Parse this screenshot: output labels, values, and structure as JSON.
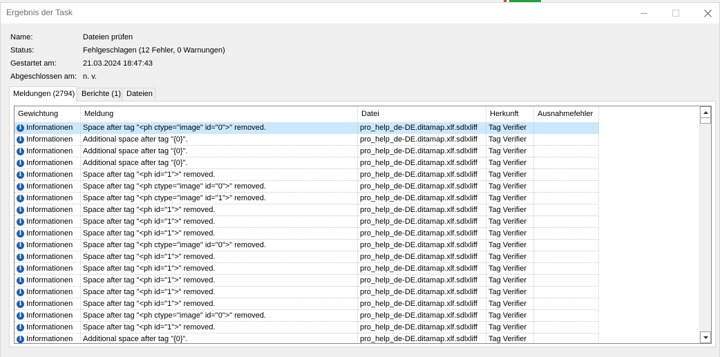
{
  "window": {
    "title": "Ergebnis der Task"
  },
  "properties": [
    {
      "label": "Name:",
      "value": "Dateien prüfen"
    },
    {
      "label": "Status:",
      "value": "Fehlgeschlagen (12 Fehler, 0 Warnungen)"
    },
    {
      "label": "Gestartet am:",
      "value": "21.03.2024 18:47:43"
    },
    {
      "label": "Abgeschlossen am:",
      "value": "n. v."
    }
  ],
  "tabs": [
    {
      "label": "Meldungen (2794)",
      "active": true
    },
    {
      "label": "Berichte (1)",
      "active": false
    },
    {
      "label": "Dateien",
      "active": false
    }
  ],
  "table": {
    "columns": [
      "Gewichtung",
      "Meldung",
      "Datei",
      "Herkunft",
      "Ausnahmefehler"
    ],
    "rows": [
      [
        "Informationen",
        "Space after tag \"<ph ctype=\"image\" id=\"0\">\" removed.",
        "pro_help_de-DE.ditamap.xlf.sdlxliff",
        "Tag Verifier",
        ""
      ],
      [
        "Informationen",
        "Additional space after tag \"{0}\".",
        "pro_help_de-DE.ditamap.xlf.sdlxliff",
        "Tag Verifier",
        ""
      ],
      [
        "Informationen",
        "Additional space after tag \"{0}\".",
        "pro_help_de-DE.ditamap.xlf.sdlxliff",
        "Tag Verifier",
        ""
      ],
      [
        "Informationen",
        "Additional space after tag \"{0}\".",
        "pro_help_de-DE.ditamap.xlf.sdlxliff",
        "Tag Verifier",
        ""
      ],
      [
        "Informationen",
        "Space after tag \"<ph id=\"1\">\" removed.",
        "pro_help_de-DE.ditamap.xlf.sdlxliff",
        "Tag Verifier",
        ""
      ],
      [
        "Informationen",
        "Space after tag \"<ph ctype=\"image\" id=\"0\">\" removed.",
        "pro_help_de-DE.ditamap.xlf.sdlxliff",
        "Tag Verifier",
        ""
      ],
      [
        "Informationen",
        "Space after tag \"<ph ctype=\"image\" id=\"1\">\" removed.",
        "pro_help_de-DE.ditamap.xlf.sdlxliff",
        "Tag Verifier",
        ""
      ],
      [
        "Informationen",
        "Space after tag \"<ph id=\"1\">\" removed.",
        "pro_help_de-DE.ditamap.xlf.sdlxliff",
        "Tag Verifier",
        ""
      ],
      [
        "Informationen",
        "Space after tag \"<ph id=\"1\">\" removed.",
        "pro_help_de-DE.ditamap.xlf.sdlxliff",
        "Tag Verifier",
        ""
      ],
      [
        "Informationen",
        "Space after tag \"<ph id=\"1\">\" removed.",
        "pro_help_de-DE.ditamap.xlf.sdlxliff",
        "Tag Verifier",
        ""
      ],
      [
        "Informationen",
        "Space after tag \"<ph ctype=\"image\" id=\"0\">\" removed.",
        "pro_help_de-DE.ditamap.xlf.sdlxliff",
        "Tag Verifier",
        ""
      ],
      [
        "Informationen",
        "Space after tag \"<ph id=\"1\">\" removed.",
        "pro_help_de-DE.ditamap.xlf.sdlxliff",
        "Tag Verifier",
        ""
      ],
      [
        "Informationen",
        "Space after tag \"<ph id=\"1\">\" removed.",
        "pro_help_de-DE.ditamap.xlf.sdlxliff",
        "Tag Verifier",
        ""
      ],
      [
        "Informationen",
        "Space after tag \"<ph id=\"1\">\" removed.",
        "pro_help_de-DE.ditamap.xlf.sdlxliff",
        "Tag Verifier",
        ""
      ],
      [
        "Informationen",
        "Space after tag \"<ph id=\"1\">\" removed.",
        "pro_help_de-DE.ditamap.xlf.sdlxliff",
        "Tag Verifier",
        ""
      ],
      [
        "Informationen",
        "Space after tag \"<ph id=\"1\">\" removed.",
        "pro_help_de-DE.ditamap.xlf.sdlxliff",
        "Tag Verifier",
        ""
      ],
      [
        "Informationen",
        "Space after tag \"<ph ctype=\"image\" id=\"0\">\" removed.",
        "pro_help_de-DE.ditamap.xlf.sdlxliff",
        "Tag Verifier",
        ""
      ],
      [
        "Informationen",
        "Space after tag \"<ph id=\"1\">\" removed.",
        "pro_help_de-DE.ditamap.xlf.sdlxliff",
        "Tag Verifier",
        ""
      ],
      [
        "Informationen",
        "Additional space after tag \"{0}\".",
        "pro_help_de-DE.ditamap.xlf.sdlxliff",
        "Tag Verifier",
        ""
      ]
    ],
    "selected_row": 0,
    "severity_icon": "info-icon"
  },
  "colors": {
    "selection": "#cce8ff",
    "info_icon": "#1f5fb4"
  }
}
